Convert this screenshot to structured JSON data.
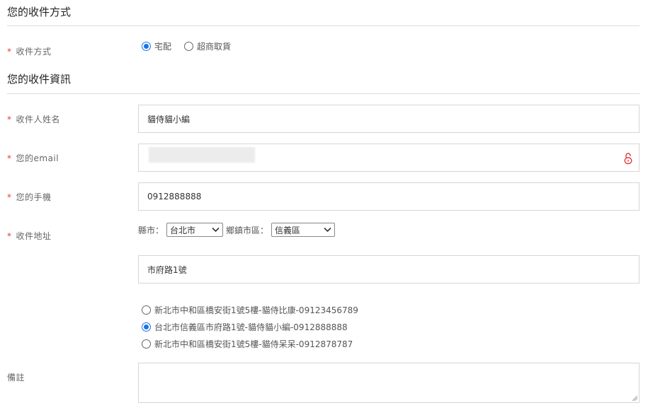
{
  "shipping": {
    "title": "您的收件方式",
    "method_label": "收件方式",
    "options": [
      {
        "label": "宅配",
        "checked": true
      },
      {
        "label": "超商取貨",
        "checked": false
      }
    ]
  },
  "recipient": {
    "title": "您的收件資訊",
    "name_label": "收件人姓名",
    "name_value": "貓侍貓小編",
    "email_label": "您的email",
    "phone_label": "您的手機",
    "phone_value": "0912888888",
    "address_label": "收件地址",
    "county_label": "縣市：",
    "county_value": "台北市",
    "district_label": "鄉鎮市區：",
    "district_value": "信義區",
    "street_value": "市府路1號",
    "saved_addresses": [
      {
        "text": "新北市中和區橋安街1號5樓-貓侍比康-09123456789",
        "checked": false
      },
      {
        "text": "台北市信義區市府路1號-貓侍貓小編-0912888888",
        "checked": true
      },
      {
        "text": "新北市中和區橋安街1號5樓-貓侍呆呆-0912878787",
        "checked": false
      }
    ],
    "note_label": "備註"
  },
  "required_mark": "*",
  "colors": {
    "accent": "#1a73e8",
    "required": "#e03b3b",
    "lock": "#e03b3b"
  },
  "icons": {
    "lock": "lock-icon",
    "chevron": "chevron-down-icon",
    "resize": "resize-grip-icon"
  }
}
